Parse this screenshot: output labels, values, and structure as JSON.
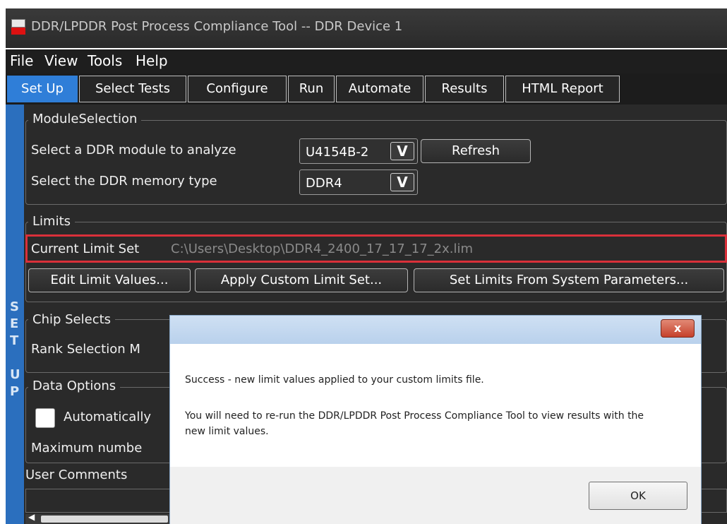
{
  "window": {
    "title": "DDR/LPDDR Post Process Compliance Tool -- DDR Device 1"
  },
  "menu": [
    "File",
    "View",
    "Tools",
    "Help"
  ],
  "tabs": [
    "Set Up",
    "Select Tests",
    "Configure",
    "Run",
    "Automate",
    "Results",
    "HTML Report"
  ],
  "side_strip": {
    "letters": [
      "S",
      "E",
      "T",
      "U",
      "P"
    ]
  },
  "module_selection": {
    "legend": "ModuleSelection",
    "module_label": "Select a DDR module to analyze",
    "module_value": "U4154B-2",
    "refresh_label": "Refresh",
    "memory_label": "Select the DDR memory type",
    "memory_value": "DDR4"
  },
  "limits": {
    "legend": "Limits",
    "current_label": "Current Limit Set",
    "current_path": "C:\\Users\\Desktop\\DDR4_2400_17_17_17_2x.lim",
    "edit_label": "Edit Limit Values...",
    "apply_label": "Apply Custom Limit Set...",
    "system_label": "Set Limits From System Parameters..."
  },
  "chip_selects": {
    "legend": "Chip Selects",
    "rank_label": "Rank Selection M"
  },
  "data_options": {
    "legend": "Data Options",
    "auto_label": "Automatically",
    "max_label": "Maximum numbe"
  },
  "user_comments": {
    "label": "User Comments"
  },
  "dialog": {
    "close_glyph": "x",
    "message_1": "Success - new limit values applied to your custom limits file.",
    "message_2": "You will need to re-run the DDR/LPDDR Post Process Compliance Tool to view results with the new limit values.",
    "ok_label": "OK"
  },
  "colors": {
    "active_tab": "#2f7ed8",
    "highlight_border": "#d9303a",
    "dialog_title": "#b9d1ec"
  }
}
